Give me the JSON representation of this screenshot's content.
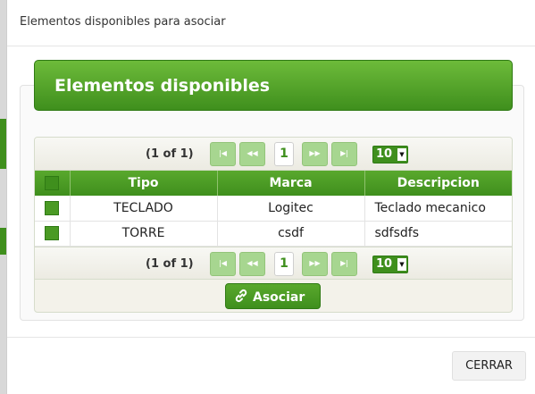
{
  "modal": {
    "title": "Elementos disponibles para asociar",
    "close_label": "CERRAR"
  },
  "panel": {
    "title": "Elementos disponibles"
  },
  "paginator": {
    "page_report": "(1 of 1)",
    "current_page": "1",
    "rows_per_page": "10",
    "buttons": [
      "first-page",
      "previous-page",
      "next-page",
      "last-page"
    ]
  },
  "table": {
    "headers": [
      "Tipo",
      "Marca",
      "Descripcion"
    ],
    "rows": [
      {
        "tipo": "TECLADO",
        "marca": "Logitec",
        "descripcion": "Teclado mecanico"
      },
      {
        "tipo": "TORRE",
        "marca": "csdf",
        "descripcion": "sdfsdfs"
      }
    ]
  },
  "actions": {
    "associate_label": "Asociar"
  },
  "colors": {
    "accent": "#3f8f1d",
    "accent_light": "#6dbb3a",
    "button_disabled": "#a7d690"
  }
}
